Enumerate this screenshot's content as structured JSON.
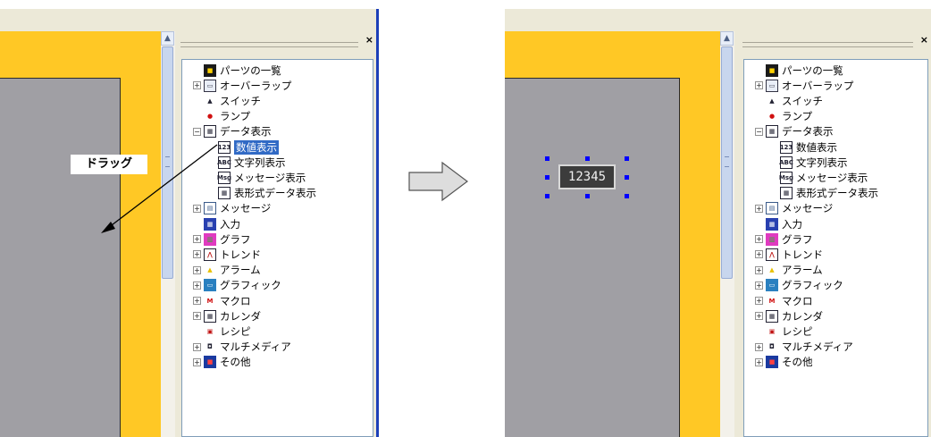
{
  "drag_label": "ドラッグ",
  "number_display_text": "12345",
  "dock": {
    "close": "×"
  },
  "scroll": {
    "up_glyph": "▲"
  },
  "tree_items": [
    {
      "label": "パーツの一覧",
      "expander": "",
      "icon": "parts-list-icon"
    },
    {
      "label": "オーバーラップ",
      "expander": "+",
      "icon": "overlap-icon"
    },
    {
      "label": "スイッチ",
      "expander": "",
      "icon": "switch-icon"
    },
    {
      "label": "ランプ",
      "expander": "",
      "icon": "lamp-icon"
    },
    {
      "label": "データ表示",
      "expander": "−",
      "icon": "data-display-icon"
    },
    {
      "label": "数値表示",
      "expander": "",
      "icon": "numeric-display-icon",
      "child": true
    },
    {
      "label": "文字列表示",
      "expander": "",
      "icon": "string-display-icon",
      "child": true
    },
    {
      "label": "メッセージ表示",
      "expander": "",
      "icon": "message-display-icon",
      "child": true
    },
    {
      "label": "表形式データ表示",
      "expander": "",
      "icon": "table-display-icon",
      "child": true
    },
    {
      "label": "メッセージ",
      "expander": "+",
      "icon": "message-icon"
    },
    {
      "label": "入力",
      "expander": "",
      "icon": "input-icon"
    },
    {
      "label": "グラフ",
      "expander": "+",
      "icon": "graph-icon"
    },
    {
      "label": "トレンド",
      "expander": "+",
      "icon": "trend-icon"
    },
    {
      "label": "アラーム",
      "expander": "+",
      "icon": "alarm-icon"
    },
    {
      "label": "グラフィック",
      "expander": "+",
      "icon": "graphic-icon"
    },
    {
      "label": "マクロ",
      "expander": "+",
      "icon": "macro-icon"
    },
    {
      "label": "カレンダ",
      "expander": "+",
      "icon": "calendar-icon"
    },
    {
      "label": "レシピ",
      "expander": "",
      "icon": "recipe-icon"
    },
    {
      "label": "マルチメディア",
      "expander": "+",
      "icon": "multimedia-icon"
    },
    {
      "label": "その他",
      "expander": "+",
      "icon": "other-icon"
    }
  ],
  "colors": {
    "screen_background": "#ffc825",
    "screen_gray": "#a09fa4",
    "selection": "#316ac5"
  }
}
